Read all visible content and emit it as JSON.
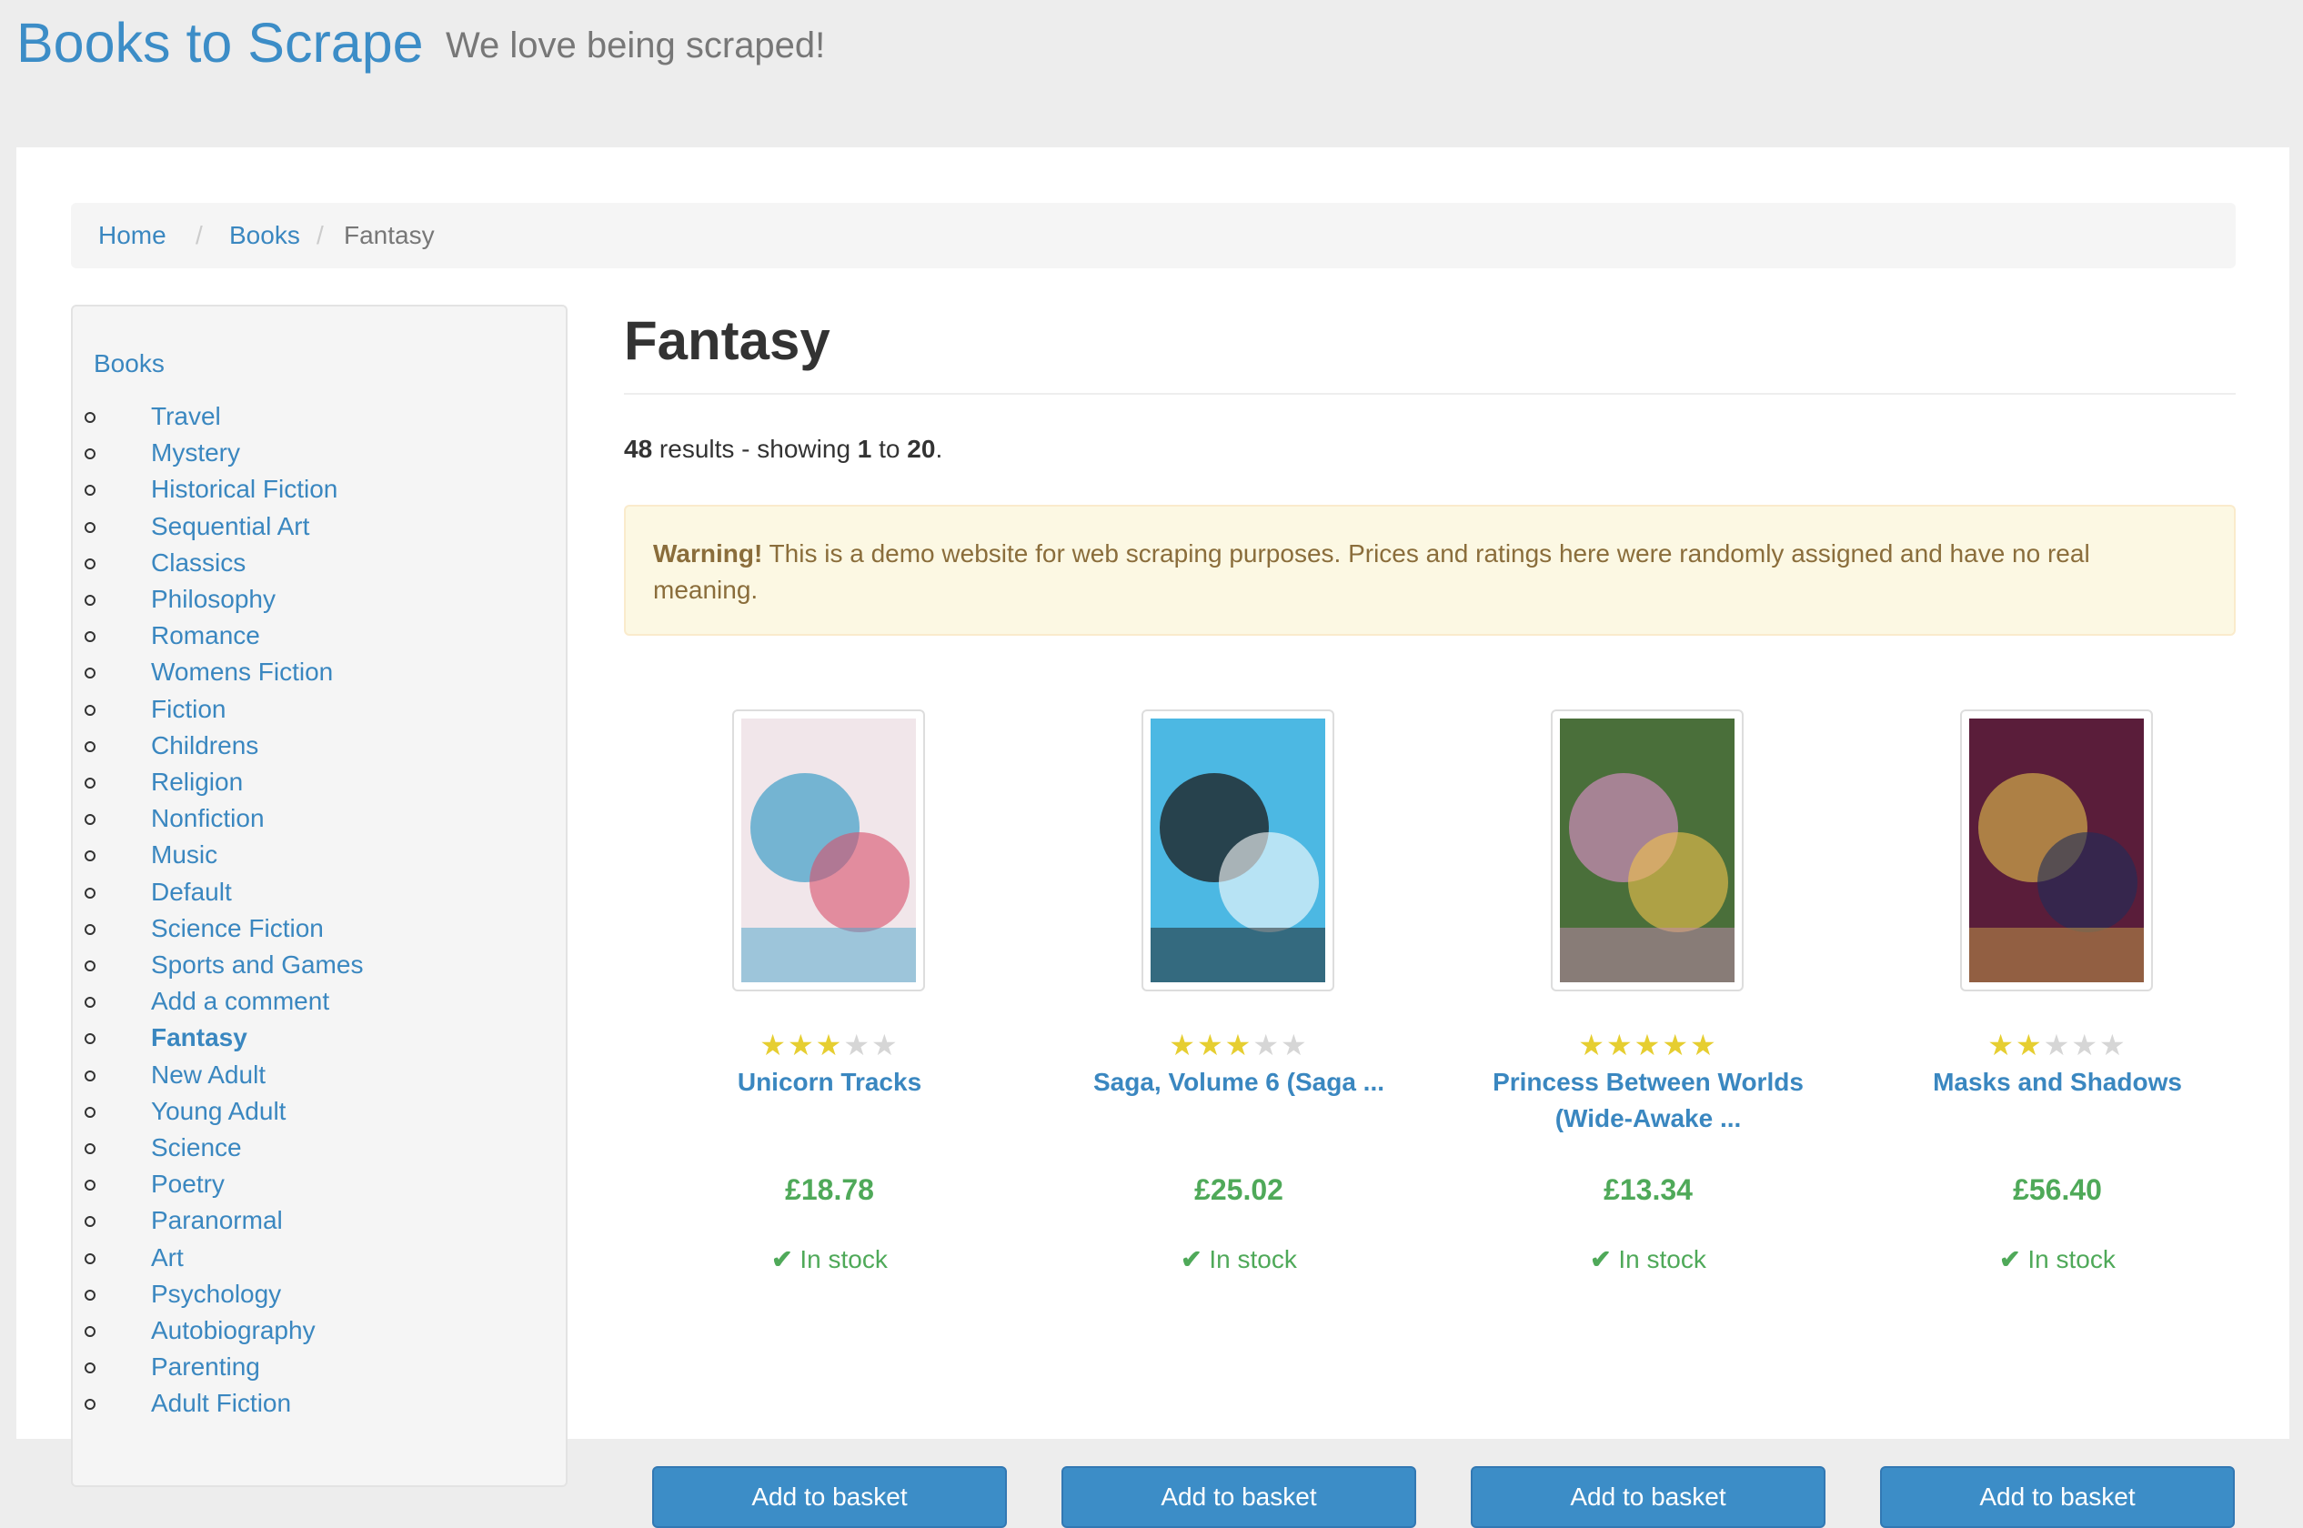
{
  "header": {
    "brand": "Books to Scrape",
    "tagline": "We love being scraped!"
  },
  "breadcrumb": [
    {
      "label": "Home",
      "link": true
    },
    {
      "label": "Books",
      "link": true
    },
    {
      "label": "Fantasy",
      "link": false
    }
  ],
  "sidebar": {
    "root": "Books",
    "categories": [
      "Travel",
      "Mystery",
      "Historical Fiction",
      "Sequential Art",
      "Classics",
      "Philosophy",
      "Romance",
      "Womens Fiction",
      "Fiction",
      "Childrens",
      "Religion",
      "Nonfiction",
      "Music",
      "Default",
      "Science Fiction",
      "Sports and Games",
      "Add a comment",
      "Fantasy",
      "New Adult",
      "Young Adult",
      "Science",
      "Poetry",
      "Paranormal",
      "Art",
      "Psychology",
      "Autobiography",
      "Parenting",
      "Adult Fiction"
    ],
    "active": "Fantasy"
  },
  "main": {
    "title": "Fantasy",
    "results": {
      "total": "48",
      "from": "1",
      "to": "20",
      "text_mid": " results - showing ",
      "text_to": " to ",
      "end": "."
    },
    "alert": {
      "strong": "Warning!",
      "text": " This is a demo website for web scraping purposes. Prices and ratings here were randomly assigned and have no real meaning."
    }
  },
  "products": [
    {
      "title": "Unicorn Tracks",
      "rating": 3,
      "price": "£18.78",
      "stock": "In stock",
      "button": "Add to basket",
      "cover_colors": [
        "#f1e6ea",
        "#4aa3c9",
        "#d9506b"
      ]
    },
    {
      "title": "Saga, Volume 6 (Saga ...",
      "rating": 3,
      "price": "£25.02",
      "stock": "In stock",
      "button": "Add to basket",
      "cover_colors": [
        "#4cb8e3",
        "#1b1b1b",
        "#ffffff"
      ]
    },
    {
      "title": "Princess Between Worlds (Wide-Awake ...",
      "rating": 5,
      "price": "£13.34",
      "stock": "In stock",
      "button": "Add to basket",
      "cover_colors": [
        "#4a6f3a",
        "#c58ab3",
        "#f1c34d"
      ]
    },
    {
      "title": "Masks and Shadows",
      "rating": 2,
      "price": "£56.40",
      "stock": "In stock",
      "button": "Add to basket",
      "cover_colors": [
        "#5a1d3a",
        "#c9a24a",
        "#1e2d5a"
      ]
    }
  ],
  "colors": {
    "link": "#3a87c0",
    "price": "#4fa959",
    "button": "#3c8dc7",
    "star_on": "#e6ce31",
    "star_off": "#d6d6d6"
  }
}
